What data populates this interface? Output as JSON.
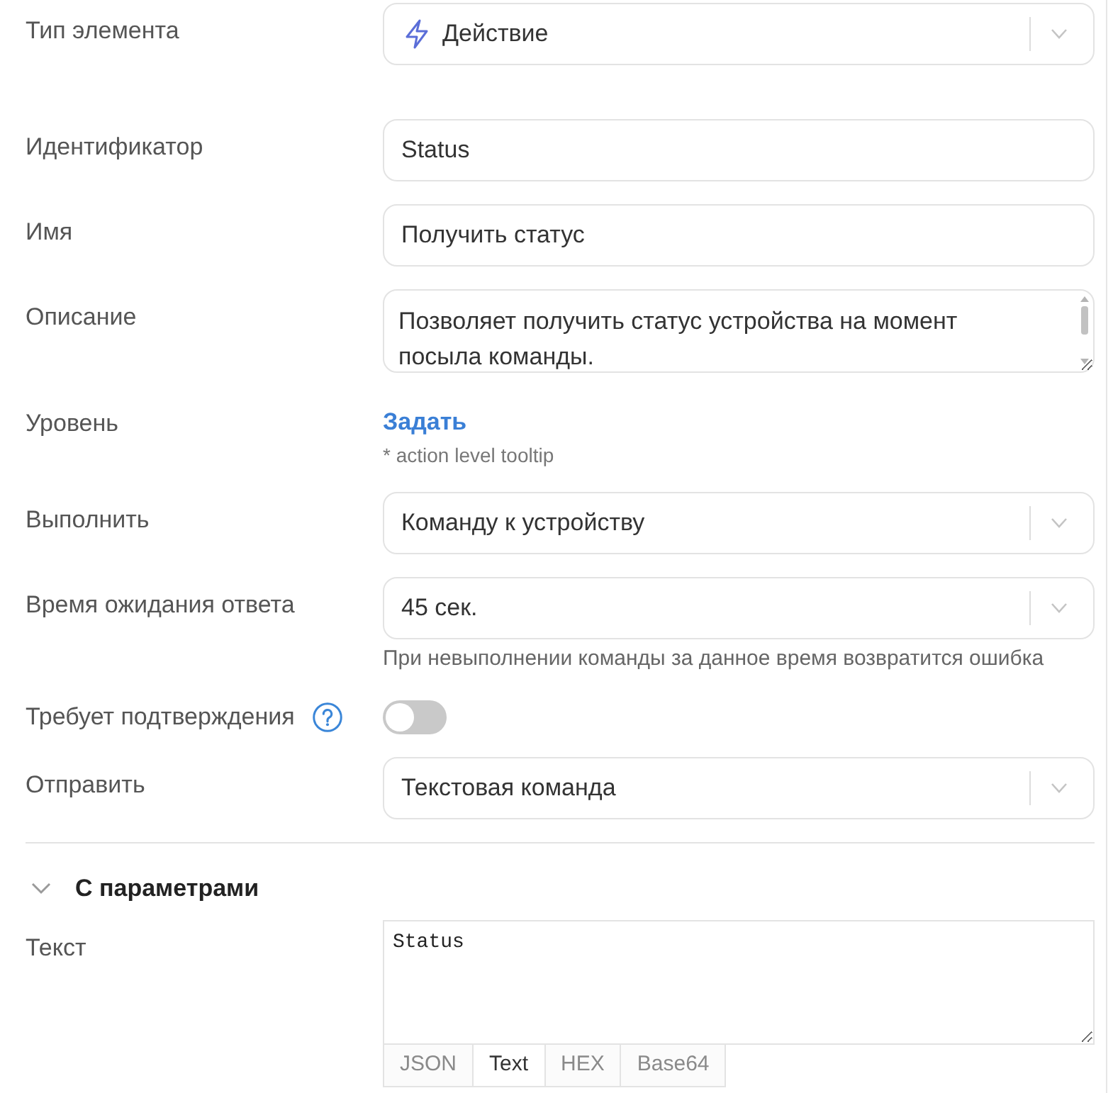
{
  "fields": [
    {
      "kind": "type_select",
      "label": "Тип элемента",
      "value": "Действие"
    },
    {
      "kind": "input",
      "label": "Идентификатор",
      "value": "Status"
    },
    {
      "kind": "input",
      "label": "Имя",
      "value": "Получить статус"
    },
    {
      "kind": "textarea",
      "label": "Описание",
      "value": "Позволяет получить статус устройства на момент посыла команды."
    },
    {
      "kind": "link",
      "label": "Уровень",
      "value": "Задать",
      "note": "* action level tooltip"
    },
    {
      "kind": "select",
      "label": "Выполнить",
      "value": "Команду к устройству"
    },
    {
      "kind": "select",
      "label": "Время ожидания ответа",
      "value": "45 сек.",
      "hint": "При невыполнении команды за данное время возвратится ошибка"
    },
    {
      "kind": "toggle",
      "label": "Требует подтверждения",
      "on": false
    },
    {
      "kind": "select",
      "label": "Отправить",
      "value": "Текстовая команда"
    }
  ],
  "section": {
    "title": "С параметрами",
    "expanded": true,
    "fields": [
      {
        "kind": "code",
        "label": "Текст",
        "value": "Status",
        "formats": [
          {
            "label": "JSON",
            "selected": false
          },
          {
            "label": "Text",
            "selected": true
          },
          {
            "label": "HEX",
            "selected": false
          },
          {
            "label": "Base64",
            "selected": false
          }
        ]
      }
    ]
  }
}
